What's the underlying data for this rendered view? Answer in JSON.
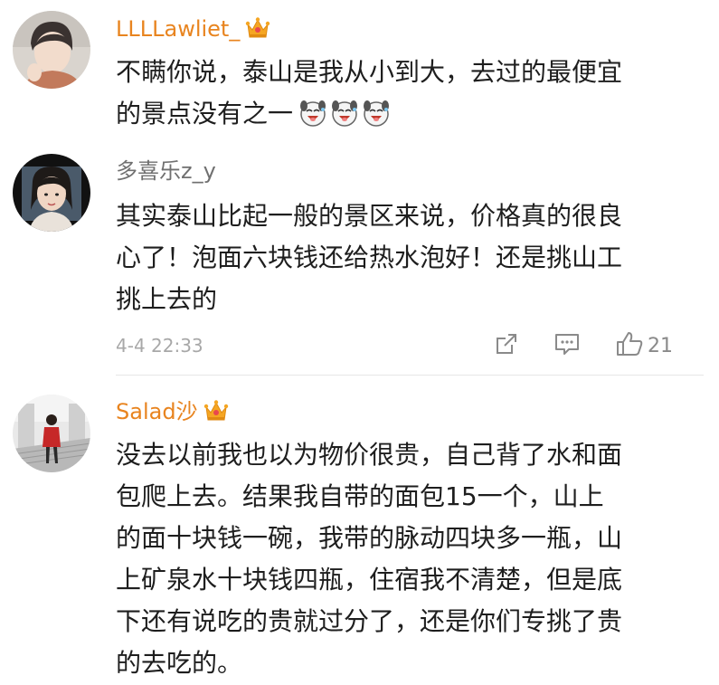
{
  "comments": [
    {
      "username": "LLLLawliet_",
      "lines": [
        "不瞒你说，泰山是我从小到大，去过的最便宜",
        "的景点没有之一"
      ]
    },
    {
      "username": "多喜乐z_y",
      "lines": [
        "其实泰山比起一般的景区来说，价格真的很良",
        "心了！泡面六块钱还给热水泡好！还是挑山工",
        "挑上去的"
      ],
      "timestamp": "4-4 22:33",
      "likes": "21"
    },
    {
      "username": "Salad沙",
      "lines": [
        "没去以前我也以为物价很贵，自己背了水和面",
        "包爬上去。结果我自带的面包15一个，山上",
        "的面十块钱一碗，我带的脉动四块多一瓶，山",
        "上矿泉水十块钱四瓶，住宿我不清楚，但是底",
        "下还有说吃的贵就过分了，还是你们专挑了贵",
        "的去吃的。"
      ]
    }
  ],
  "colors": {
    "vip_name": "#e8841f",
    "normal_name": "#707070",
    "text": "#1e1e1e",
    "meta": "#a8a8a8"
  },
  "icons": [
    "crown-icon",
    "laughing-dog-emoji",
    "share-icon",
    "comment-icon",
    "thumbs-up-icon"
  ]
}
